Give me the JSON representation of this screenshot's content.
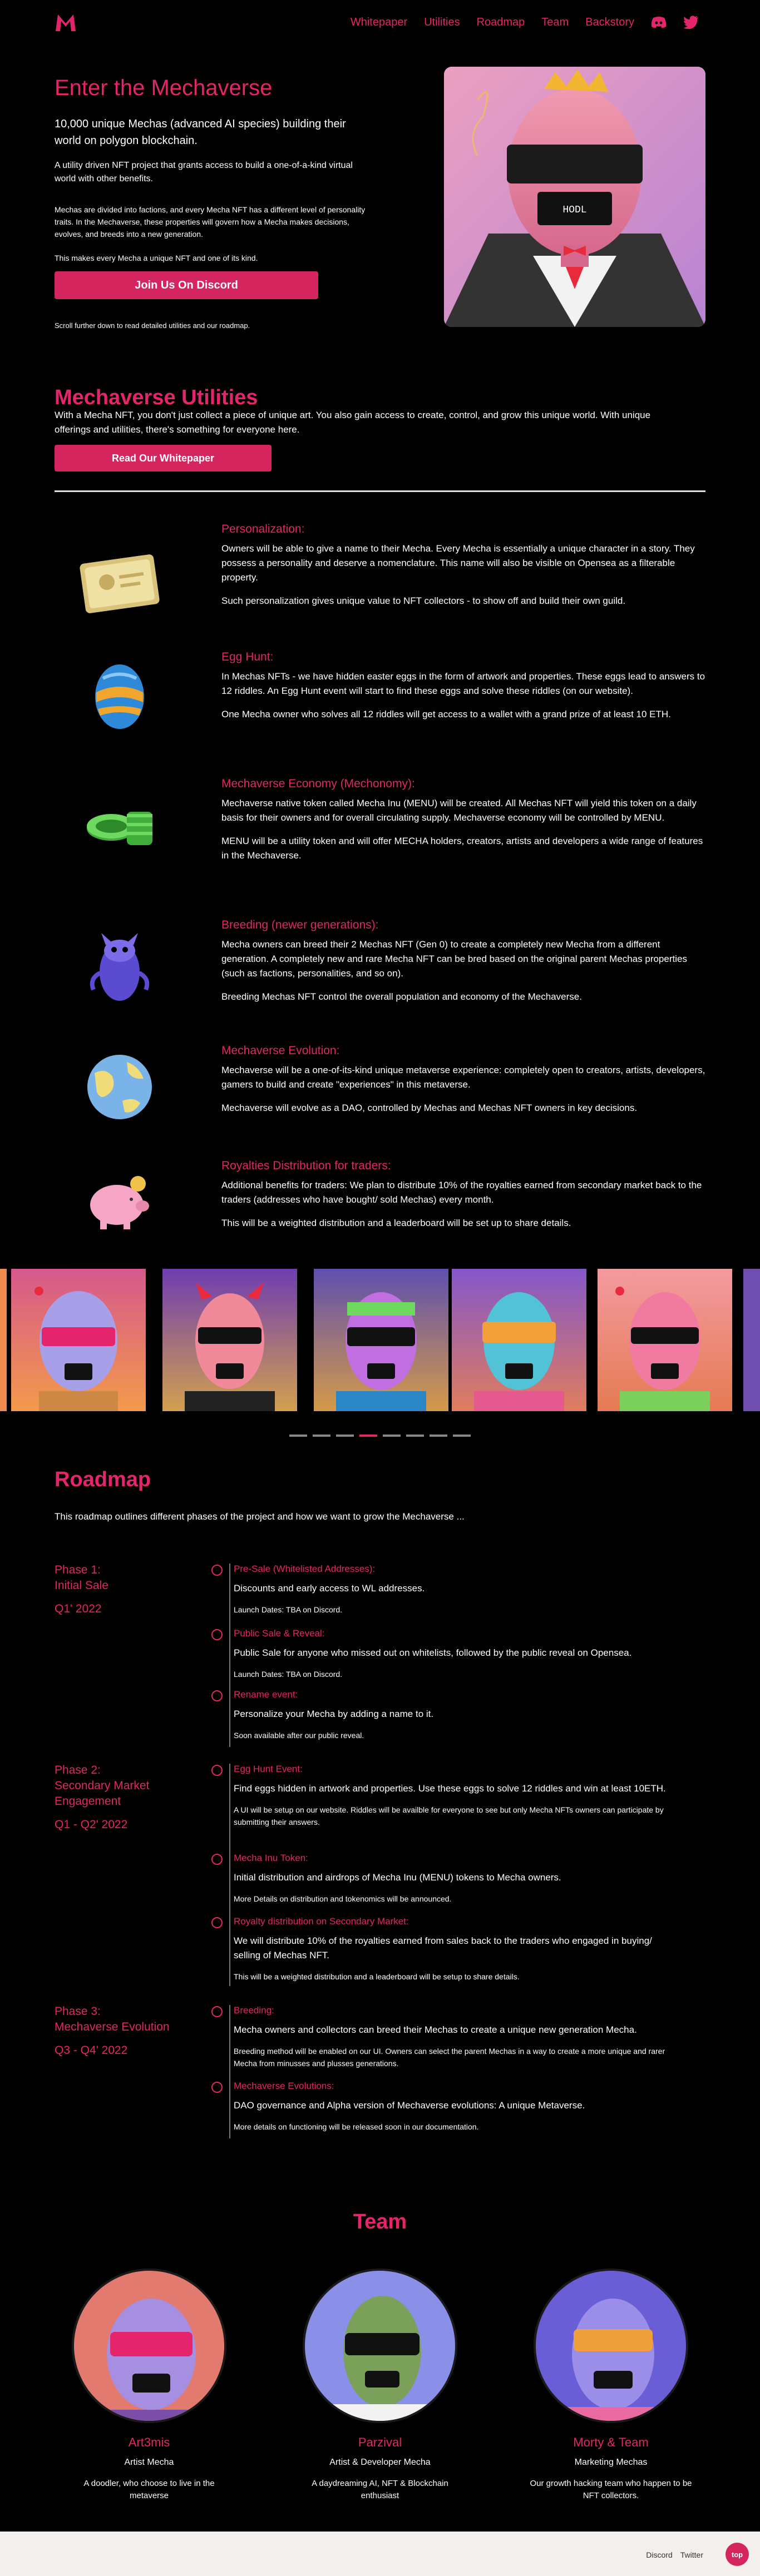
{
  "nav": {
    "links": [
      "Whitepaper",
      "Utilities",
      "Roadmap",
      "Team",
      "Backstory"
    ],
    "icons": [
      "discord-icon",
      "twitter-icon"
    ]
  },
  "hero": {
    "title": "Enter the Mechaverse",
    "subtitle": "10,000 unique Mechas (advanced AI species) building their world on polygon blockchain.",
    "p1": "A utility driven NFT project that grants access to build a one-of-a-kind virtual world with other benefits.",
    "p2": "Mechas are divided into factions, and every Mecha NFT has a different level of personality traits. In the Mechaverse, these properties will govern how a Mecha makes decisions, evolves, and breeds into a new generation.",
    "p3": "This makes every Mecha a unique NFT and one of its kind.",
    "discord_button": "Join Us On Discord",
    "scroll_note": "Scroll further down to read detailed utilities and our roadmap.",
    "visor_text": "HODL"
  },
  "utilities": {
    "title": "Mechaverse Utilities",
    "intro": "With a Mecha NFT, you don't just collect a piece of unique art. You also gain access to create, control, and grow this unique world. With unique offerings and utilities, there's something for everyone here.",
    "whitepaper_button": "Read Our Whitepaper",
    "items": [
      {
        "title": "Personalization:",
        "p1": "Owners will be able to give a name to their Mecha. Every Mecha is essentially a unique character in a story. They possess a personality and deserve a nomenclature. This name will also be visible on Opensea as a filterable property.",
        "p2": "Such personalization gives unique value to NFT collectors - to show off and build their own guild."
      },
      {
        "title": "Egg Hunt:",
        "p1": "In Mechas NFTs - we have hidden easter eggs in the form of artwork and properties. These eggs lead to answers to 12 riddles. An Egg Hunt event will start to find these eggs and solve these riddles (on our website).",
        "p2": "One Mecha owner who solves all 12 riddles will get access to a wallet with a grand prize of at least 10 ETH."
      },
      {
        "title": "Mechaverse Economy (Mechonomy):",
        "p1": "Mechaverse native token called Mecha Inu (MENU) will be created. All Mechas NFT will yield this token on a daily basis for their owners and for overall circulating supply. Mechaverse economy will be controlled by MENU.",
        "p2": "MENU will be a utility token and will offer MECHA holders, creators, artists and developers a wide range of features in the Mechaverse."
      },
      {
        "title": "Breeding (newer generations):",
        "p1": "Mecha owners can breed their 2 Mechas NFT (Gen 0) to create a completely new Mecha from a different generation. A completely new and rare Mecha NFT can be bred based on the original parent Mechas properties (such as factions, personalities, and so on).",
        "p2": "Breeding Mechas NFT control the overall population and economy of the Mechaverse."
      },
      {
        "title": "Mechaverse Evolution:",
        "p1": "Mechaverse will be a one-of-its-kind unique metaverse experience: completely open to creators, artists, developers, gamers to build and create \"experiences\" in this metaverse.",
        "p2": "Mechaverse will evolve as a DAO, controlled by Mechas and Mechas NFT owners in key decisions."
      },
      {
        "title": "Royalties Distribution for traders:",
        "p1": "Additional benefits for traders: We plan to distribute 10% of the royalties earned from secondary market back to the traders (addresses who have bought/ sold Mechas) every month.",
        "p2": "This will be a weighted distribution and a leaderboard will be set up to share details."
      }
    ]
  },
  "roadmap": {
    "title": "Roadmap",
    "intro": "This roadmap outlines different phases of the project and how we want to grow the Mechaverse ...",
    "phases": [
      {
        "name": "Phase 1:",
        "subtitle": "Initial Sale",
        "date": "Q1' 2022"
      },
      {
        "name": "Phase 2:",
        "subtitle": "Secondary Market Engagement",
        "date": "Q1 - Q2' 2022"
      },
      {
        "name": "Phase 3:",
        "subtitle": "Mechaverse Evolution",
        "date": "Q3 - Q4' 2022"
      }
    ],
    "items": [
      {
        "title": "Pre-Sale (Whitelisted Addresses):",
        "p": "Discounts and early access to WL addresses.",
        "note": "Launch Dates: TBA on Discord."
      },
      {
        "title": "Public Sale & Reveal:",
        "p": "Public Sale for anyone who missed out on whitelists, followed by the public reveal on Opensea.",
        "note": "Launch Dates: TBA on Discord."
      },
      {
        "title": "Rename event:",
        "p": "Personalize your Mecha by adding a name to it.",
        "note": "Soon available after our public reveal."
      },
      {
        "title": "Egg Hunt Event:",
        "p": "Find eggs hidden in artwork and properties. Use these eggs to solve 12 riddles and win at least 10ETH.",
        "note": "A UI will be setup on our website. Riddles will be availble for everyone to see but only Mecha NFTs owners can participate by submitting their answers."
      },
      {
        "title": "Mecha Inu Token:",
        "p": "Initial distribution and airdrops of Mecha Inu (MENU) tokens to Mecha owners.",
        "note": "More Details on distribution and tokenomics will be announced."
      },
      {
        "title": "Royalty distribution on Secondary Market:",
        "p": "We will distribute 10% of the royalties earned from sales back to the traders who engaged in buying/ selling of Mechas NFT.",
        "note": "This will be a weighted distribution and a leaderboard will be setup to share details."
      },
      {
        "title": "Breeding:",
        "p": "Mecha owners and collectors can breed their Mechas to create a unique new generation Mecha.",
        "note": "Breeding method will be enabled on our UI. Owners can select the parent Mechas in a way to create a more unique and rarer Mecha from minusses and plusses generations."
      },
      {
        "title": "Mechaverse Evolutions:",
        "p": "DAO governance and Alpha version of Mechaverse evolutions: A unique Metaverse.",
        "note": "More details on functioning will be released soon in our documentation."
      }
    ]
  },
  "team": {
    "title": "Team",
    "members": [
      {
        "name": "Art3mis",
        "role": "Artist Mecha",
        "desc": "A doodler, who choose to live in the metaverse"
      },
      {
        "name": "Parzival",
        "role": "Artist & Developer Mecha",
        "desc": "A daydreaming AI, NFT & Blockchain enthusiast"
      },
      {
        "name": "Morty & Team",
        "role": "Marketing Mechas",
        "desc": "Our growth hacking team who happen to be NFT collectors."
      }
    ]
  },
  "carousel": {
    "slide_count": 8,
    "active_index": 3
  },
  "footer": {
    "links": [
      "Discord",
      "Twitter"
    ],
    "top_button": "top"
  }
}
